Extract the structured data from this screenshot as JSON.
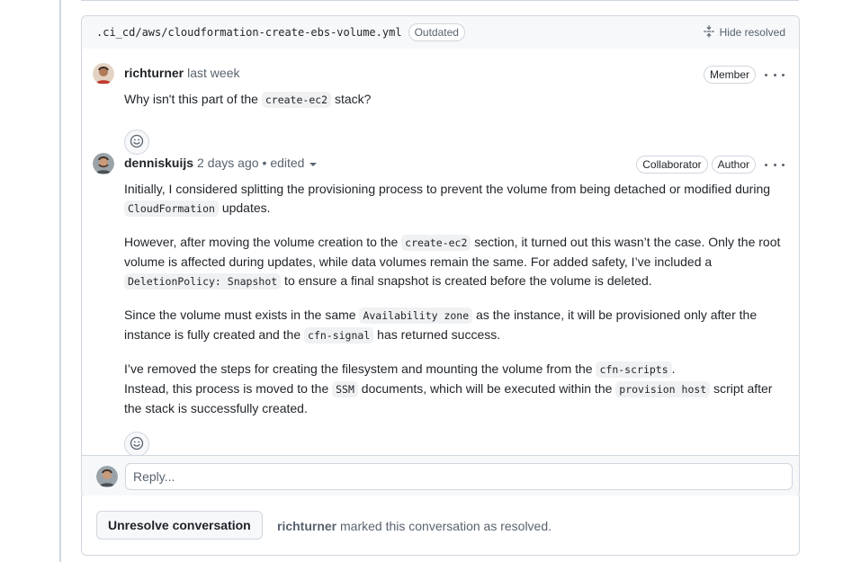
{
  "thread": {
    "file_path": ".ci_cd/aws/cloudformation-create-ebs-volume.yml",
    "outdated_label": "Outdated",
    "hide_resolved_label": "Hide resolved"
  },
  "comments": [
    {
      "author": "richturner",
      "time": "last week",
      "badges": [
        "Member"
      ],
      "body": {
        "p1_a": "Why isn't this part of the ",
        "p1_code": "create-ec2",
        "p1_b": " stack?"
      }
    },
    {
      "author": "denniskuijs",
      "time": "2 days ago",
      "edited": "• edited",
      "badges": [
        "Collaborator",
        "Author"
      ],
      "body": {
        "p1_a": "Initially, I considered splitting the provisioning process to prevent the volume from being detached or modified during ",
        "p1_code": "CloudFormation",
        "p1_b": " updates.",
        "p2_a": "However, after moving the volume creation to the ",
        "p2_code1": "create-ec2",
        "p2_b": " section, it turned out this wasn’t the case. Only the root volume is affected during updates, while data volumes remain the same. For added safety, I’ve included a ",
        "p2_code2": "DeletionPolicy: Snapshot",
        "p2_c": " to ensure a final snapshot is created before the volume is deleted.",
        "p3_a": "Since the volume must exists in the same ",
        "p3_code1": "Availability zone",
        "p3_b": " as the instance, it will be provisioned only after the instance is fully created and the ",
        "p3_code2": "cfn-signal",
        "p3_c": " has returned success.",
        "p4_a": "I’ve removed the steps for creating the filesystem and mounting the volume from the ",
        "p4_code1": "cfn-scripts",
        "p4_b": ".",
        "p4_c": "Instead, this process is moved to the ",
        "p4_code2": "SSM",
        "p4_d": " documents, which will be executed within the ",
        "p4_code3": "provision host",
        "p4_e": " script after the stack is successfully created."
      }
    }
  ],
  "reply": {
    "placeholder": "Reply..."
  },
  "resolved": {
    "button_label": "Unresolve conversation",
    "author": "richturner",
    "message": " marked this conversation as resolved."
  },
  "icons": {
    "hide_resolved": "fold-icon",
    "react": "smiley-icon",
    "more": "kebab-horizontal-icon"
  }
}
